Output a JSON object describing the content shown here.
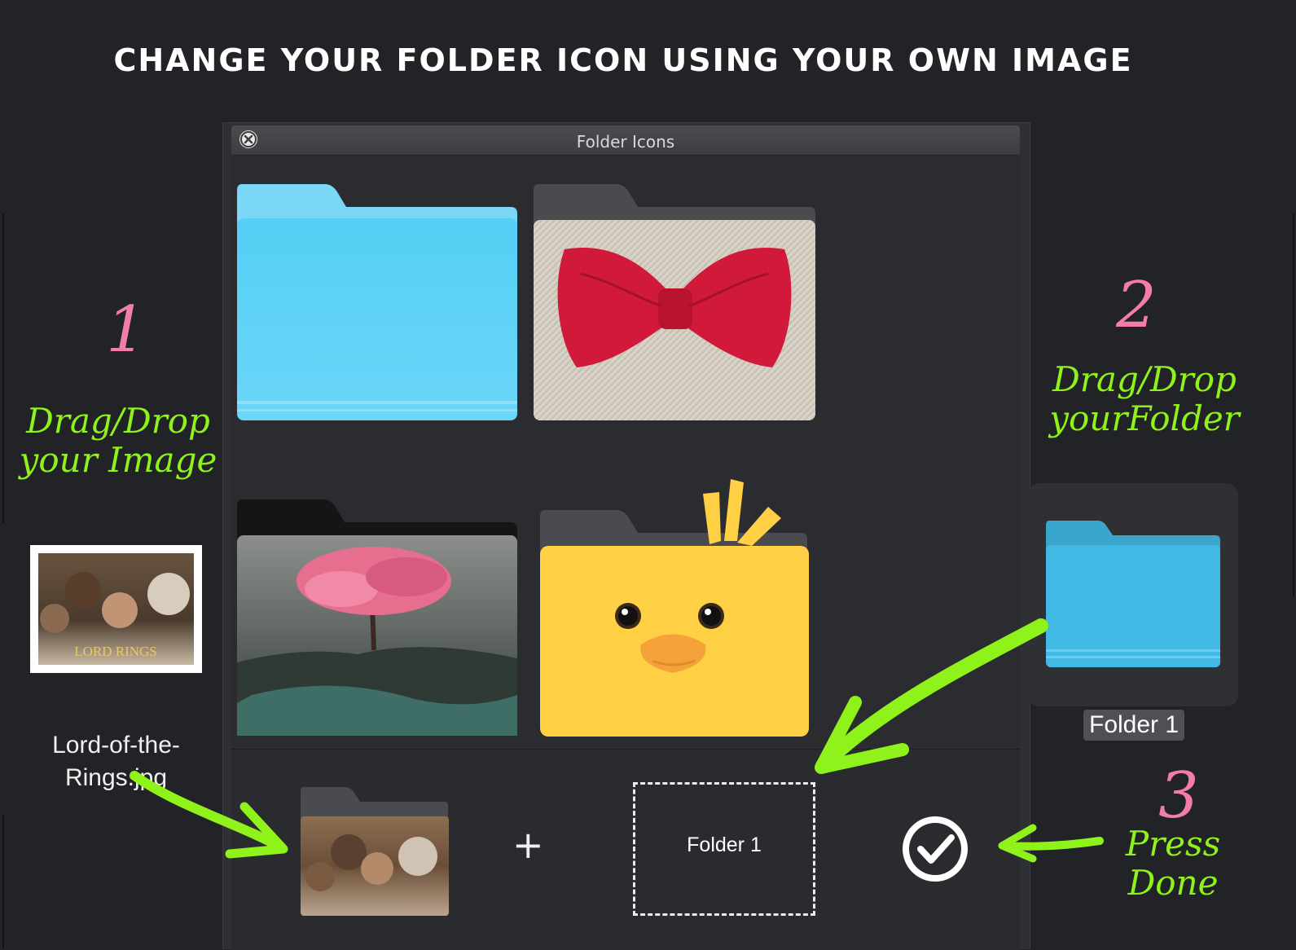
{
  "headline": "CHANGE YOUR FOLDER ICON USING YOUR OWN IMAGE",
  "window": {
    "title": "Folder Icons",
    "icons": [
      {
        "name": "blue-folder",
        "style": "plain blue"
      },
      {
        "name": "bowtie-folder",
        "style": "red bow tie photo"
      },
      {
        "name": "tree-folder",
        "style": "pink tree landscape"
      },
      {
        "name": "duck-folder",
        "style": "yellow duck"
      }
    ],
    "bottom": {
      "plus": "+",
      "drop_target_label": "Folder 1",
      "done_icon": "checkmark-circle-icon"
    }
  },
  "steps": {
    "step1": {
      "number": "1",
      "line1": "Drag/Drop",
      "line2": "your Image"
    },
    "step2": {
      "number": "2",
      "line1": "Drag/Drop",
      "line2": "yourFolder"
    },
    "step3": {
      "number": "3",
      "line1": "Press",
      "line2": "Done"
    }
  },
  "source_file": {
    "name_line1": "Lord-of-the-",
    "name_line2": "Rings.jpg",
    "poster_text": "LORD RINGS"
  },
  "target_folder": {
    "label": "Folder 1"
  },
  "colors": {
    "background": "#222326",
    "accent_green": "#8ff21a",
    "accent_pink": "#f27dac",
    "folder_blue": "#4fcdf4",
    "duck_yellow": "#ffcf44"
  }
}
